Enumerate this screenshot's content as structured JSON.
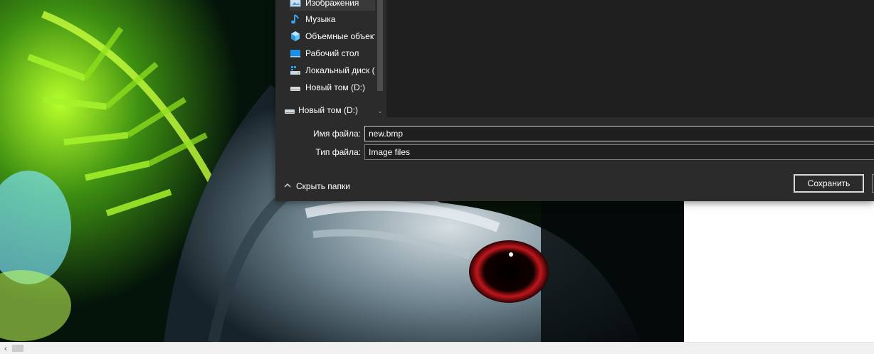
{
  "dialog": {
    "nav_items": [
      {
        "label": "Изображения",
        "icon": "pictures-folder-icon"
      },
      {
        "label": "Музыка",
        "icon": "music-note-icon"
      },
      {
        "label": "Объемные объекты",
        "icon": "3d-objects-icon"
      },
      {
        "label": "Рабочий стол",
        "icon": "desktop-icon"
      },
      {
        "label": "Локальный диск (C:)",
        "icon": "local-disk-icon"
      },
      {
        "label": "Новый том (D:)",
        "icon": "drive-icon"
      }
    ],
    "nav_drive": {
      "label": "Новый том (D:)",
      "icon": "drive-icon"
    },
    "file_name_label": "Имя файла:",
    "file_name_value": "new.bmp",
    "file_type_label": "Тип файла:",
    "file_type_value": "Image files",
    "hide_folders_label": "Скрыть папки",
    "save_label": "Сохранить"
  },
  "colors": {
    "dialog_bg": "#2b2b2b",
    "content_bg": "#1f1f1f",
    "accent_blue": "#4cc2ff"
  }
}
